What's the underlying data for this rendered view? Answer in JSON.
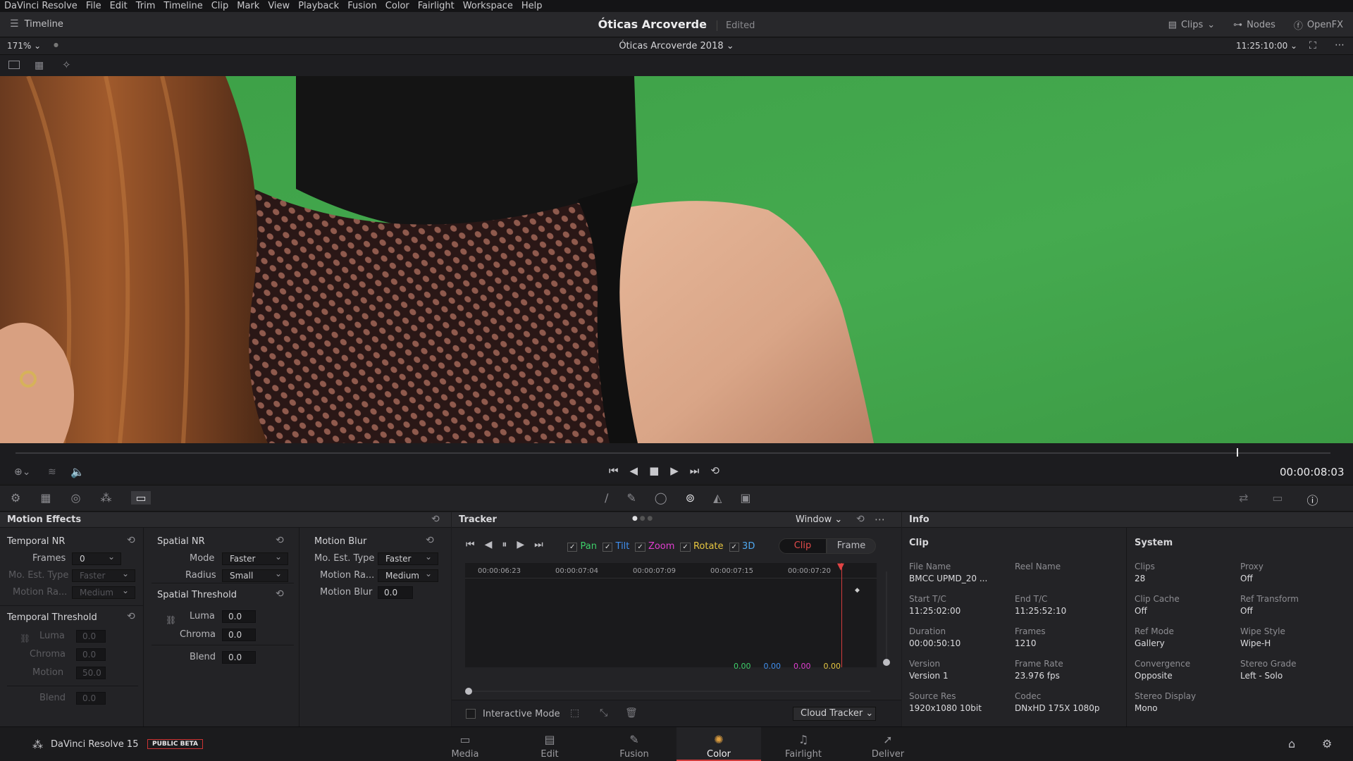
{
  "menu": [
    "DaVinci Resolve",
    "File",
    "Edit",
    "Trim",
    "Timeline",
    "Clip",
    "Mark",
    "View",
    "Playback",
    "Fusion",
    "Color",
    "Fairlight",
    "Workspace",
    "Help"
  ],
  "titlebar": {
    "timeline_label": "Timeline",
    "project": "Óticas Arcoverde",
    "status": "Edited",
    "clips": "Clips",
    "nodes": "Nodes",
    "openfx": "OpenFX"
  },
  "viewer": {
    "zoom": "171%",
    "timeline_name": "Óticas Arcoverde 2018",
    "timecode": "11:25:10:00",
    "playhead_tc": "00:00:08:03"
  },
  "motion_effects": {
    "title": "Motion Effects",
    "temporal_nr": {
      "title": "Temporal NR",
      "frames_label": "Frames",
      "frames": "0",
      "mo_est_label": "Mo. Est. Type",
      "mo_est": "Faster",
      "motion_range_label": "Motion Ra...",
      "motion_range": "Medium"
    },
    "temporal_threshold": {
      "title": "Temporal Threshold",
      "luma_label": "Luma",
      "luma": "0.0",
      "chroma_label": "Chroma",
      "chroma": "0.0",
      "motion_label": "Motion",
      "motion": "50.0",
      "blend_label": "Blend",
      "blend": "0.0"
    },
    "spatial_nr": {
      "title": "Spatial NR",
      "mode_label": "Mode",
      "mode": "Faster",
      "radius_label": "Radius",
      "radius": "Small"
    },
    "spatial_threshold": {
      "title": "Spatial Threshold",
      "luma_label": "Luma",
      "luma": "0.0",
      "chroma_label": "Chroma",
      "chroma": "0.0",
      "blend_label": "Blend",
      "blend": "0.0"
    },
    "motion_blur": {
      "title": "Motion Blur",
      "mo_est_label": "Mo. Est. Type",
      "mo_est": "Faster",
      "motion_range_label": "Motion Ra...",
      "motion_range": "Medium",
      "blur_label": "Motion Blur",
      "blur": "0.0"
    }
  },
  "tracker": {
    "title": "Tracker",
    "mode": "Window",
    "checks": [
      {
        "label": "Pan",
        "color": "#3ecf6a"
      },
      {
        "label": "Tilt",
        "color": "#3f8ff0"
      },
      {
        "label": "Zoom",
        "color": "#e23fd1"
      },
      {
        "label": "Rotate",
        "color": "#e7c640"
      },
      {
        "label": "3D",
        "color": "#4fa8f0"
      }
    ],
    "clip_btn": "Clip",
    "frame_btn": "Frame",
    "ruler": [
      "00:00:06:23",
      "00:00:07:04",
      "00:00:07:09",
      "00:00:07:15",
      "00:00:07:20"
    ],
    "values": [
      {
        "v": "0.00",
        "color": "#3ecf6a"
      },
      {
        "v": "0.00",
        "color": "#3f8ff0"
      },
      {
        "v": "0.00",
        "color": "#e23fd1"
      },
      {
        "v": "0.00",
        "color": "#e7c640"
      }
    ],
    "interactive_mode": "Interactive Mode",
    "cloud_tracker": "Cloud Tracker"
  },
  "info": {
    "title": "Info",
    "clip_title": "Clip",
    "clip": [
      {
        "k": "File Name",
        "v": "BMCC UPMD_20 ..."
      },
      {
        "k": "Reel Name",
        "v": ""
      },
      {
        "k": "Start T/C",
        "v": "11:25:02:00"
      },
      {
        "k": "End T/C",
        "v": "11:25:52:10"
      },
      {
        "k": "Duration",
        "v": "00:00:50:10"
      },
      {
        "k": "Frames",
        "v": "1210"
      },
      {
        "k": "Version",
        "v": "Version 1"
      },
      {
        "k": "Frame Rate",
        "v": "23.976 fps"
      },
      {
        "k": "Source Res",
        "v": "1920x1080 10bit"
      },
      {
        "k": "Codec",
        "v": "DNxHD 175X 1080p"
      }
    ],
    "system_title": "System",
    "system": [
      {
        "k": "Clips",
        "v": "28"
      },
      {
        "k": "Proxy",
        "v": "Off"
      },
      {
        "k": "Clip Cache",
        "v": "Off"
      },
      {
        "k": "Ref Transform",
        "v": "Off"
      },
      {
        "k": "Ref Mode",
        "v": "Gallery"
      },
      {
        "k": "Wipe Style",
        "v": "Wipe-H"
      },
      {
        "k": "Convergence",
        "v": "Opposite"
      },
      {
        "k": "Stereo Grade",
        "v": "Left - Solo"
      },
      {
        "k": "Stereo Display",
        "v": "Mono"
      },
      {
        "k": "",
        "v": ""
      }
    ]
  },
  "bottom": {
    "app_name": "DaVinci Resolve 15",
    "beta": "PUBLIC BETA",
    "pages": [
      "Media",
      "Edit",
      "Fusion",
      "Color",
      "Fairlight",
      "Deliver"
    ],
    "active": "Color"
  }
}
